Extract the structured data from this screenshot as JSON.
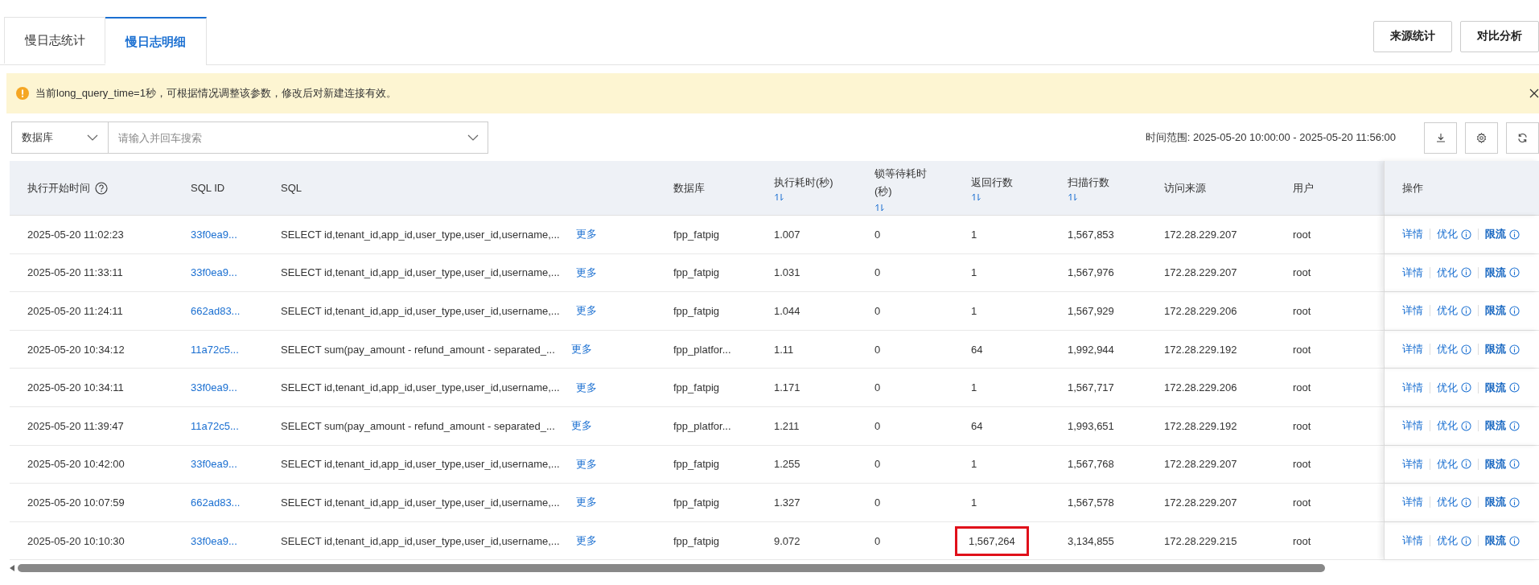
{
  "tabs": [
    {
      "label": "慢日志统计",
      "selected": false
    },
    {
      "label": "慢日志明细",
      "selected": true
    }
  ],
  "header_buttons": [
    "来源统计",
    "对比分析"
  ],
  "notice": {
    "text": "当前long_query_time=1秒，可根据情况调整该参数，修改后对新建连接有效。"
  },
  "filter": {
    "field_select": "数据库",
    "search_placeholder": "请输入并回车搜索"
  },
  "time_range": "时间范围: 2025-05-20 10:00:00 - 2025-05-20 11:56:00",
  "table": {
    "columns": [
      {
        "label": "执行开始时间",
        "kind": "help"
      },
      {
        "label": "SQL ID",
        "kind": "plain"
      },
      {
        "label": "SQL",
        "kind": "plain"
      },
      {
        "label": "数据库",
        "kind": "plain"
      },
      {
        "label": "执行耗时(秒)",
        "kind": "sort"
      },
      {
        "label": "锁等待耗时(秒)",
        "kind": "sort"
      },
      {
        "label": "返回行数",
        "kind": "sort"
      },
      {
        "label": "扫描行数",
        "kind": "sort"
      },
      {
        "label": "访问来源",
        "kind": "plain"
      },
      {
        "label": "用户",
        "kind": "plain"
      },
      {
        "label": "操作",
        "kind": "plain"
      }
    ],
    "rows": [
      {
        "time": "2025-05-20 11:02:23",
        "sql_id": "33f0ea9...",
        "sql": "SELECT id,tenant_id,app_id,user_type,user_id,username,...",
        "more": "更多",
        "database": "fpp_fatpig",
        "exec_time": "1.007",
        "lock_time": "0",
        "returned": "1",
        "returned_marked": false,
        "scanned": "1,567,853",
        "source": "172.28.229.207",
        "user": "root",
        "actions": [
          {
            "label": "详情",
            "info": false,
            "strong": false
          },
          {
            "label": "优化",
            "info": true,
            "strong": false
          },
          {
            "label": "限流",
            "info": true,
            "strong": true
          }
        ]
      },
      {
        "time": "2025-05-20 11:33:11",
        "sql_id": "33f0ea9...",
        "sql": "SELECT id,tenant_id,app_id,user_type,user_id,username,...",
        "more": "更多",
        "database": "fpp_fatpig",
        "exec_time": "1.031",
        "lock_time": "0",
        "returned": "1",
        "returned_marked": false,
        "scanned": "1,567,976",
        "source": "172.28.229.207",
        "user": "root",
        "actions": [
          {
            "label": "详情",
            "info": false,
            "strong": false
          },
          {
            "label": "优化",
            "info": true,
            "strong": false
          },
          {
            "label": "限流",
            "info": true,
            "strong": true
          }
        ]
      },
      {
        "time": "2025-05-20 11:24:11",
        "sql_id": "662ad83...",
        "sql": "SELECT id,tenant_id,app_id,user_type,user_id,username,...",
        "more": "更多",
        "database": "fpp_fatpig",
        "exec_time": "1.044",
        "lock_time": "0",
        "returned": "1",
        "returned_marked": false,
        "scanned": "1,567,929",
        "source": "172.28.229.206",
        "user": "root",
        "actions": [
          {
            "label": "详情",
            "info": false,
            "strong": false
          },
          {
            "label": "优化",
            "info": true,
            "strong": false
          },
          {
            "label": "限流",
            "info": true,
            "strong": true
          }
        ]
      },
      {
        "time": "2025-05-20 10:34:12",
        "sql_id": "11a72c5...",
        "sql": "SELECT sum(pay_amount - refund_amount - separated_...",
        "more": "更多",
        "database": "fpp_platfor...",
        "exec_time": "1.11",
        "lock_time": "0",
        "returned": "64",
        "returned_marked": false,
        "scanned": "1,992,944",
        "source": "172.28.229.192",
        "user": "root",
        "actions": [
          {
            "label": "详情",
            "info": false,
            "strong": false
          },
          {
            "label": "优化",
            "info": true,
            "strong": false
          },
          {
            "label": "限流",
            "info": true,
            "strong": true
          }
        ]
      },
      {
        "time": "2025-05-20 10:34:11",
        "sql_id": "33f0ea9...",
        "sql": "SELECT id,tenant_id,app_id,user_type,user_id,username,...",
        "more": "更多",
        "database": "fpp_fatpig",
        "exec_time": "1.171",
        "lock_time": "0",
        "returned": "1",
        "returned_marked": false,
        "scanned": "1,567,717",
        "source": "172.28.229.206",
        "user": "root",
        "actions": [
          {
            "label": "详情",
            "info": false,
            "strong": false
          },
          {
            "label": "优化",
            "info": true,
            "strong": false
          },
          {
            "label": "限流",
            "info": true,
            "strong": true
          }
        ]
      },
      {
        "time": "2025-05-20 11:39:47",
        "sql_id": "11a72c5...",
        "sql": "SELECT sum(pay_amount - refund_amount - separated_...",
        "more": "更多",
        "database": "fpp_platfor...",
        "exec_time": "1.211",
        "lock_time": "0",
        "returned": "64",
        "returned_marked": false,
        "scanned": "1,993,651",
        "source": "172.28.229.192",
        "user": "root",
        "actions": [
          {
            "label": "详情",
            "info": false,
            "strong": false
          },
          {
            "label": "优化",
            "info": true,
            "strong": false
          },
          {
            "label": "限流",
            "info": true,
            "strong": true
          }
        ]
      },
      {
        "time": "2025-05-20 10:42:00",
        "sql_id": "33f0ea9...",
        "sql": "SELECT id,tenant_id,app_id,user_type,user_id,username,...",
        "more": "更多",
        "database": "fpp_fatpig",
        "exec_time": "1.255",
        "lock_time": "0",
        "returned": "1",
        "returned_marked": false,
        "scanned": "1,567,768",
        "source": "172.28.229.207",
        "user": "root",
        "actions": [
          {
            "label": "详情",
            "info": false,
            "strong": false
          },
          {
            "label": "优化",
            "info": true,
            "strong": false
          },
          {
            "label": "限流",
            "info": true,
            "strong": true
          }
        ]
      },
      {
        "time": "2025-05-20 10:07:59",
        "sql_id": "662ad83...",
        "sql": "SELECT id,tenant_id,app_id,user_type,user_id,username,...",
        "more": "更多",
        "database": "fpp_fatpig",
        "exec_time": "1.327",
        "lock_time": "0",
        "returned": "1",
        "returned_marked": false,
        "scanned": "1,567,578",
        "source": "172.28.229.207",
        "user": "root",
        "actions": [
          {
            "label": "详情",
            "info": false,
            "strong": false
          },
          {
            "label": "优化",
            "info": true,
            "strong": false
          },
          {
            "label": "限流",
            "info": true,
            "strong": true
          }
        ]
      },
      {
        "time": "2025-05-20 10:10:30",
        "sql_id": "33f0ea9...",
        "sql": "SELECT id,tenant_id,app_id,user_type,user_id,username,...",
        "more": "更多",
        "database": "fpp_fatpig",
        "exec_time": "9.072",
        "lock_time": "0",
        "returned": "1,567,264",
        "returned_marked": true,
        "scanned": "3,134,855",
        "source": "172.28.229.215",
        "user": "root",
        "actions": [
          {
            "label": "详情",
            "info": false,
            "strong": false
          },
          {
            "label": "优化",
            "info": true,
            "strong": false
          },
          {
            "label": "限流",
            "info": true,
            "strong": true
          }
        ]
      }
    ]
  }
}
